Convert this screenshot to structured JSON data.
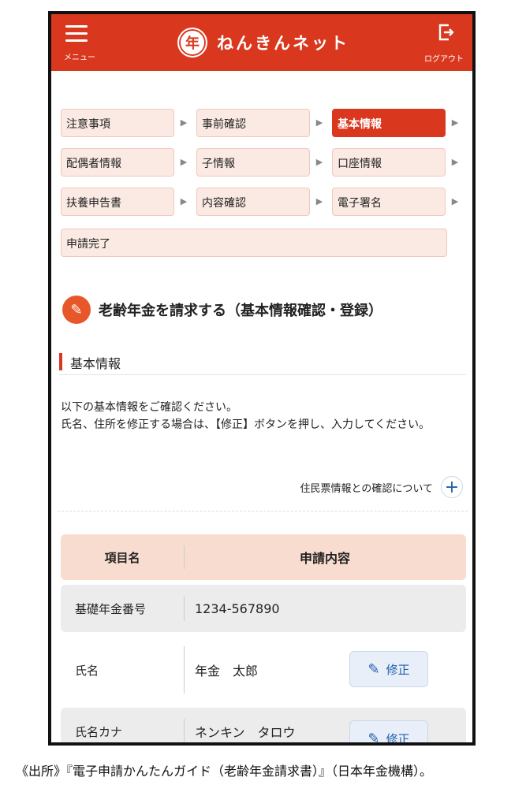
{
  "header": {
    "menu_label": "メニュー",
    "app_title": "ねんきんネット",
    "logo_glyph": "年",
    "logout_label": "ログアウト",
    "brand_color": "#d9381e"
  },
  "steps": [
    {
      "label": "注意事項",
      "active": false
    },
    {
      "label": "事前確認",
      "active": false
    },
    {
      "label": "基本情報",
      "active": true
    },
    {
      "label": "配偶者情報",
      "active": false
    },
    {
      "label": "子情報",
      "active": false
    },
    {
      "label": "口座情報",
      "active": false
    },
    {
      "label": "扶養申告書",
      "active": false
    },
    {
      "label": "内容確認",
      "active": false
    },
    {
      "label": "電子署名",
      "active": false
    },
    {
      "label": "申請完了",
      "active": false
    }
  ],
  "page_title": "老齢年金を請求する（基本情報確認・登録）",
  "section_heading": "基本情報",
  "intro": {
    "line1": "以下の基本情報をご確認ください。",
    "line2": "氏名、住所を修正する場合は、【修正】ボタンを押し、入力してください。"
  },
  "resident_link": "住民票情報との確認について",
  "table": {
    "headers": [
      "項目名",
      "申請内容"
    ],
    "rows": [
      {
        "item": "基礎年金番号",
        "value": "1234-567890"
      },
      {
        "item": "氏名",
        "value": "年金　太郎",
        "action": "修正"
      },
      {
        "item": "氏名カナ",
        "value": "ネンキン　タロウ",
        "action": "修正"
      }
    ]
  },
  "caption": "《出所》『電子申請かんたんガイド（老齢年金請求書）』（日本年金機構）。"
}
